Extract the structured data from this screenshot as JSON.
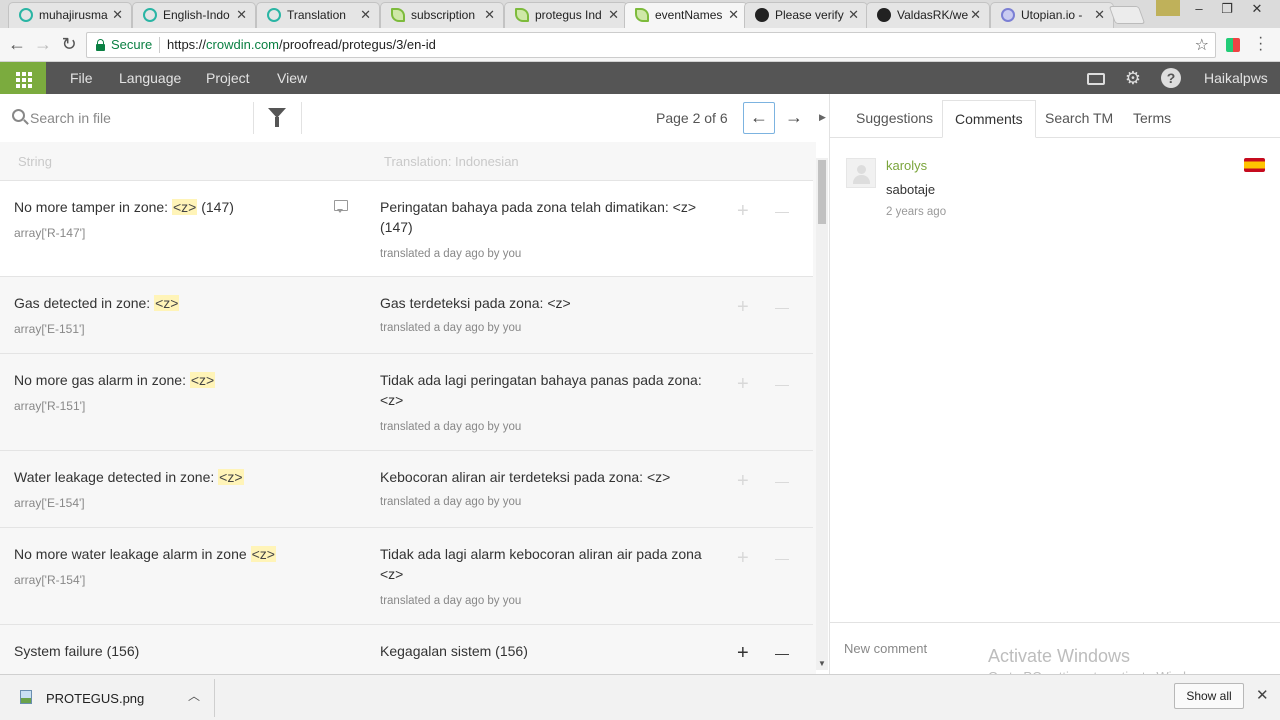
{
  "browser": {
    "tabs": [
      {
        "title": "muhajirusma",
        "icon": "ring"
      },
      {
        "title": "English-Indo",
        "icon": "ring"
      },
      {
        "title": "Translation",
        "icon": "ring"
      },
      {
        "title": "subscription",
        "icon": "leaf"
      },
      {
        "title": "protegus Ind",
        "icon": "leaf"
      },
      {
        "title": "eventNames",
        "icon": "leaf"
      },
      {
        "title": "Please verify",
        "icon": "github"
      },
      {
        "title": "ValdasRK/we",
        "icon": "github"
      },
      {
        "title": "Utopian.io -",
        "icon": "utopian"
      }
    ],
    "active_tab_index": 5,
    "tab_close_glyph": "✕",
    "address": {
      "secure_label": "Secure",
      "url_scheme": "https://",
      "url_host": "crowdin.com",
      "url_path": "/proofread/protegus/3/en-id"
    }
  },
  "appbar": {
    "menu": [
      "File",
      "Language",
      "Project",
      "View"
    ],
    "username": "Haikalpws",
    "accent_color": "#7bab3e"
  },
  "editor": {
    "search_placeholder": "Search in file",
    "page_label": "Page 2 of 6",
    "column_source": "String",
    "column_translation": "Translation: Indonesian",
    "rows": [
      {
        "source_prefix": "No more tamper in zone: ",
        "placeholder": "<z>",
        "source_suffix": " (147)",
        "key": "array['R-147']",
        "translation": "Peringatan bahaya pada zona telah dimatikan: <z> (147)",
        "meta": "translated a day ago by you",
        "selected": true,
        "has_comment": true
      },
      {
        "source_prefix": "Gas detected in zone: ",
        "placeholder": "<z>",
        "source_suffix": "",
        "key": "array['E-151']",
        "translation": "Gas terdeteksi pada zona: <z>",
        "meta": "translated a day ago by you"
      },
      {
        "source_prefix": "No more gas alarm in zone: ",
        "placeholder": "<z>",
        "source_suffix": "",
        "key": "array['R-151']",
        "translation": "Tidak ada lagi peringatan bahaya panas pada zona: <z>",
        "meta": "translated a day ago by you"
      },
      {
        "source_prefix": "Water leakage detected in zone: ",
        "placeholder": "<z>",
        "source_suffix": "",
        "key": "array['E-154']",
        "translation": "Kebocoran aliran air terdeteksi pada zona: <z>",
        "meta": "translated a day ago by you"
      },
      {
        "source_prefix": "No more water leakage alarm in zone ",
        "placeholder": "<z>",
        "source_suffix": "",
        "key": "array['R-154']",
        "translation": "Tidak ada lagi alarm kebocoran aliran air pada zona <z>",
        "meta": "translated a day ago by you"
      },
      {
        "source_prefix": "System failure (156)",
        "placeholder": "",
        "source_suffix": "",
        "key": "",
        "translation": "Kegagalan sistem (156)",
        "meta": ""
      }
    ]
  },
  "sidepanel": {
    "tabs": [
      "Suggestions",
      "Comments",
      "Search TM",
      "Terms"
    ],
    "active_tab": "Comments",
    "comment": {
      "user": "karolys",
      "text": "sabotaje",
      "time": "2 years ago",
      "flag": "spain-flag"
    },
    "new_comment_placeholder": "New comment"
  },
  "watermark": {
    "line1": "Activate Windows",
    "line2": "Go to PC settings to activate Windows."
  },
  "downloads": {
    "file_name": "PROTEGUS.png",
    "show_all_label": "Show all"
  }
}
